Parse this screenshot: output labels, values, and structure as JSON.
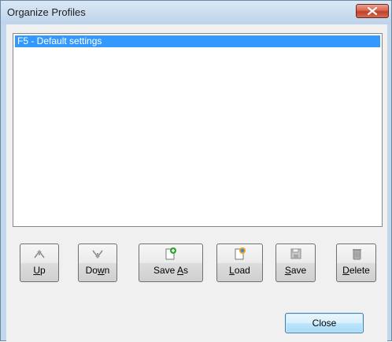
{
  "window": {
    "title": "Organize Profiles"
  },
  "profiles": {
    "items": [
      {
        "label": "F5 - Default settings",
        "selected": true
      }
    ]
  },
  "toolbar": {
    "up": {
      "label": "Up",
      "mnemonic": "U",
      "rest": "p"
    },
    "down": {
      "label": "Down",
      "pre": "Do",
      "mnemonic": "w",
      "rest": "n"
    },
    "saveas": {
      "label": "Save As",
      "pre": "Save ",
      "mnemonic": "A",
      "rest": "s"
    },
    "load": {
      "label": "Load",
      "mnemonic": "L",
      "rest": "oad"
    },
    "save": {
      "label": "Save",
      "mnemonic": "S",
      "rest": "ave"
    },
    "delete": {
      "label": "Delete",
      "mnemonic": "D",
      "rest": "elete"
    }
  },
  "footer": {
    "close_label": "Close"
  },
  "colors": {
    "selection": "#3399ff",
    "frame": "#c3d7ea",
    "close_red": "#c0402a"
  }
}
